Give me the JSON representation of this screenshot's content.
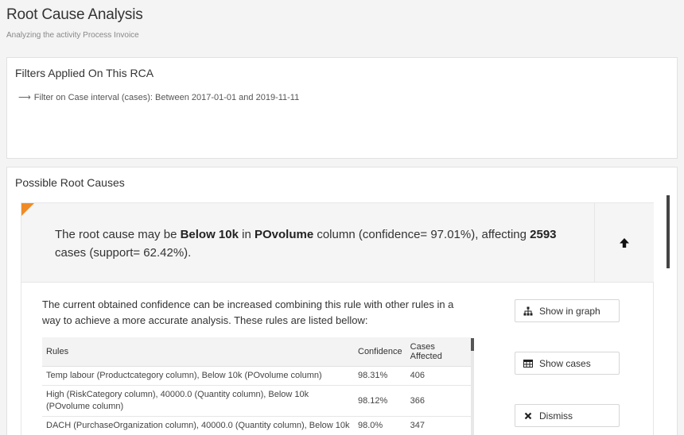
{
  "header": {
    "title": "Root Cause Analysis",
    "subtitle": "Analyzing the activity Process Invoice"
  },
  "filters": {
    "title": "Filters Applied On This RCA",
    "items": [
      "Filter on Case interval (cases): Between 2017-01-01 and 2019-11-11"
    ]
  },
  "causes": {
    "title": "Possible Root Causes",
    "cause": {
      "prefix": "The root cause may be ",
      "value": "Below 10k",
      "in_word": " in ",
      "column": "POvolume",
      "middle": " column (confidence= 97.01%), affecting ",
      "cases": "2593",
      "suffix": " cases (support= 62.42%)."
    },
    "description": "The current obtained confidence can be increased combining this rule with other rules in a way to achieve a more accurate analysis. These rules are listed bellow:",
    "table": {
      "headers": [
        "Rules",
        "Confidence",
        "Cases Affected"
      ],
      "rows": [
        [
          "Temp labour (Productcategory column), Below 10k (POvolume column)",
          "98.31%",
          "406"
        ],
        [
          "High (RiskCategory column), 40000.0 (Quantity column), Below 10k (POvolume column)",
          "98.12%",
          "366"
        ],
        [
          "DACH (PurchaseOrganization column), 40000.0 (Quantity column), Below 10k",
          "98.0%",
          "347"
        ]
      ]
    },
    "actions": {
      "graph": "Show in graph",
      "cases": "Show cases",
      "dismiss": "Dismiss"
    }
  },
  "colors": {
    "accent": "#f08a24",
    "header_bg": "#f5f5f5"
  },
  "icons": [
    "arrow-right-icon",
    "corner-flag-icon",
    "arrow-up-icon",
    "sitemap-icon",
    "table-icon",
    "close-icon"
  ]
}
